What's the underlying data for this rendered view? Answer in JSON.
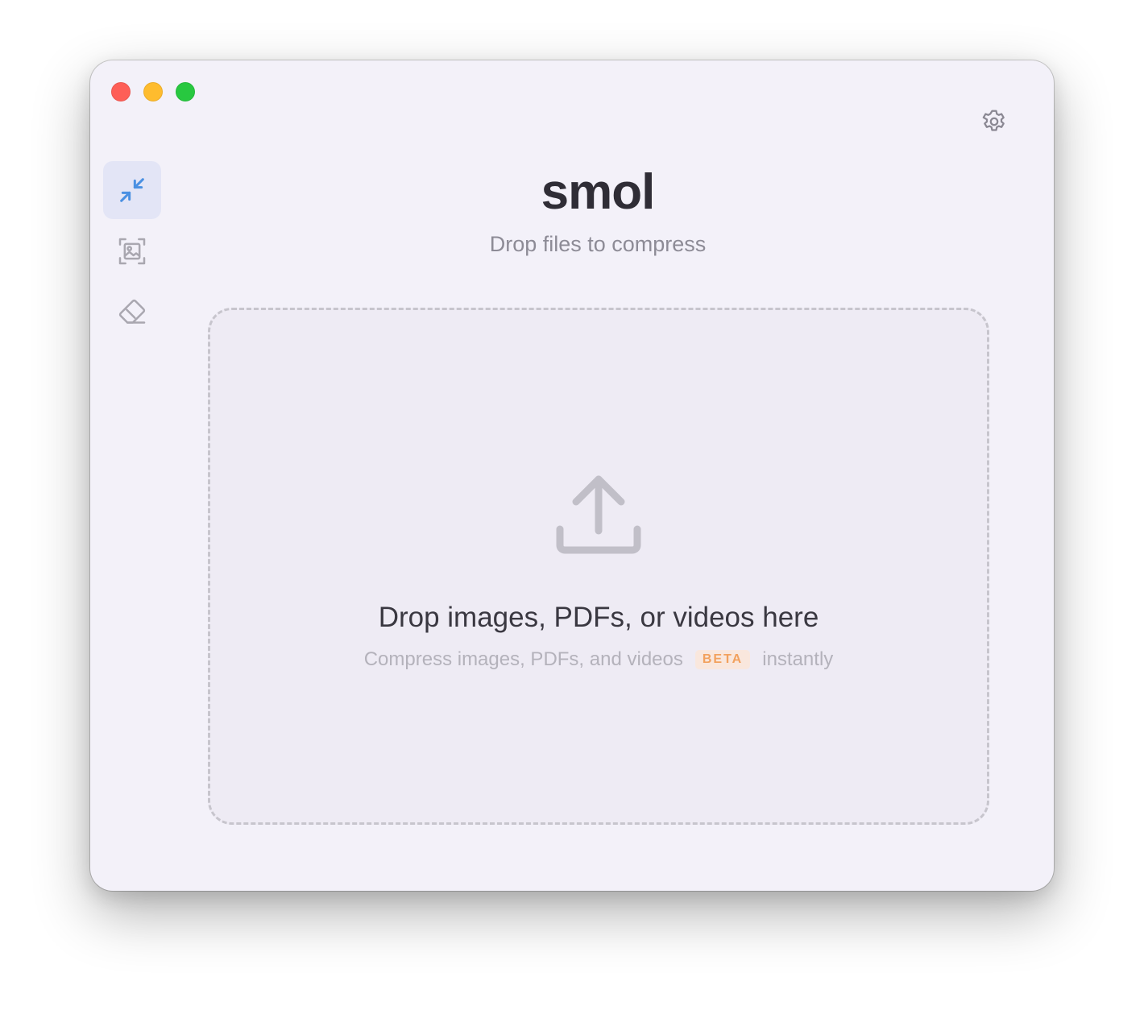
{
  "window": {
    "title": "smol",
    "subtitle": "Drop files to compress"
  },
  "sidebar": {
    "items": [
      {
        "id": "compress",
        "icon": "compress-arrows-icon",
        "active": true
      },
      {
        "id": "image",
        "icon": "image-frame-icon",
        "active": false
      },
      {
        "id": "eraser",
        "icon": "eraser-icon",
        "active": false
      }
    ]
  },
  "toolbar": {
    "settings_icon": "gear-icon"
  },
  "dropzone": {
    "icon": "upload-tray-icon",
    "title": "Drop images, PDFs, or videos here",
    "subtitle_before": "Compress images, PDFs, and videos",
    "badge": "BETA",
    "subtitle_after": "instantly"
  },
  "colors": {
    "window_bg": "#f3f1f9",
    "active_item_bg": "#e3e5f6",
    "accent_blue": "#4a90e2",
    "badge_bg": "#f9e7dd",
    "badge_text": "#f2a15e"
  }
}
